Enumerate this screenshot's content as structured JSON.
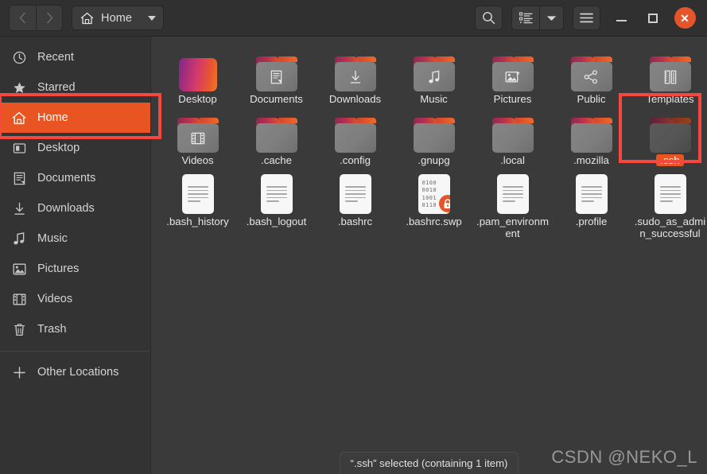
{
  "window": {
    "title": "Home",
    "nav": {
      "back_label": "‹",
      "forward_label": "›"
    },
    "controls": {
      "minimize_label": "",
      "maximize_label": "",
      "close_label": "✕"
    }
  },
  "toolbar": {
    "path_button_label": "Home",
    "search_label": "",
    "view_list_label": "",
    "view_dropdown_label": "",
    "menu_label": ""
  },
  "sidebar": {
    "items": [
      {
        "label": "Recent",
        "icon": "clock-icon",
        "active": false
      },
      {
        "label": "Starred",
        "icon": "star-icon",
        "active": false
      },
      {
        "label": "Home",
        "icon": "home-icon",
        "active": true
      },
      {
        "label": "Desktop",
        "icon": "desktop-icon",
        "active": false
      },
      {
        "label": "Documents",
        "icon": "document-icon",
        "active": false
      },
      {
        "label": "Downloads",
        "icon": "download-icon",
        "active": false
      },
      {
        "label": "Music",
        "icon": "music-icon",
        "active": false
      },
      {
        "label": "Pictures",
        "icon": "picture-icon",
        "active": false
      },
      {
        "label": "Videos",
        "icon": "video-icon",
        "active": false
      },
      {
        "label": "Trash",
        "icon": "trash-icon",
        "active": false
      }
    ],
    "other_locations": {
      "label": "Other Locations",
      "icon": "plus-icon"
    }
  },
  "files": [
    {
      "name": "Desktop",
      "type": "wallpaper",
      "emblem": "",
      "selected": false
    },
    {
      "name": "Documents",
      "type": "folder",
      "emblem": "document-icon",
      "selected": false
    },
    {
      "name": "Downloads",
      "type": "folder",
      "emblem": "download-icon",
      "selected": false
    },
    {
      "name": "Music",
      "type": "folder",
      "emblem": "music-icon",
      "selected": false
    },
    {
      "name": "Pictures",
      "type": "folder",
      "emblem": "picture-icon",
      "selected": false
    },
    {
      "name": "Public",
      "type": "folder",
      "emblem": "share-icon",
      "selected": false
    },
    {
      "name": "Templates",
      "type": "folder",
      "emblem": "template-icon",
      "selected": false
    },
    {
      "name": "Videos",
      "type": "folder",
      "emblem": "video-icon",
      "selected": false
    },
    {
      "name": ".cache",
      "type": "folder",
      "emblem": "",
      "selected": false
    },
    {
      "name": ".config",
      "type": "folder",
      "emblem": "",
      "selected": false
    },
    {
      "name": ".gnupg",
      "type": "folder",
      "emblem": "",
      "selected": false
    },
    {
      "name": ".local",
      "type": "folder",
      "emblem": "",
      "selected": false
    },
    {
      "name": ".mozilla",
      "type": "folder",
      "emblem": "",
      "selected": false
    },
    {
      "name": ".ssh",
      "type": "folder",
      "emblem": "",
      "selected": true
    },
    {
      "name": ".bash_history",
      "type": "document",
      "emblem": "",
      "selected": false
    },
    {
      "name": ".bash_logout",
      "type": "document",
      "emblem": "",
      "selected": false
    },
    {
      "name": ".bashrc",
      "type": "document",
      "emblem": "",
      "selected": false
    },
    {
      "name": ".bashrc.swp",
      "type": "binary",
      "emblem": "lock-icon",
      "selected": false
    },
    {
      "name": ".pam_environment",
      "type": "document",
      "emblem": "",
      "selected": false
    },
    {
      "name": ".profile",
      "type": "document",
      "emblem": "",
      "selected": false
    },
    {
      "name": ".sudo_as_admin_successful",
      "type": "document",
      "emblem": "",
      "selected": false
    }
  ],
  "binary_rows": [
    "0100",
    "0010",
    "1001",
    "0110"
  ],
  "statusbar": {
    "text": "“.ssh” selected (containing 1 item)"
  },
  "watermark": {
    "text": "CSDN @NEKO_L"
  },
  "colors": {
    "accent": "#e85523",
    "close": "#e6542a",
    "annotation": "#f9463f",
    "sidebar_bg": "#333333",
    "main_bg": "#3a3a3a",
    "header_bg": "#303030"
  }
}
